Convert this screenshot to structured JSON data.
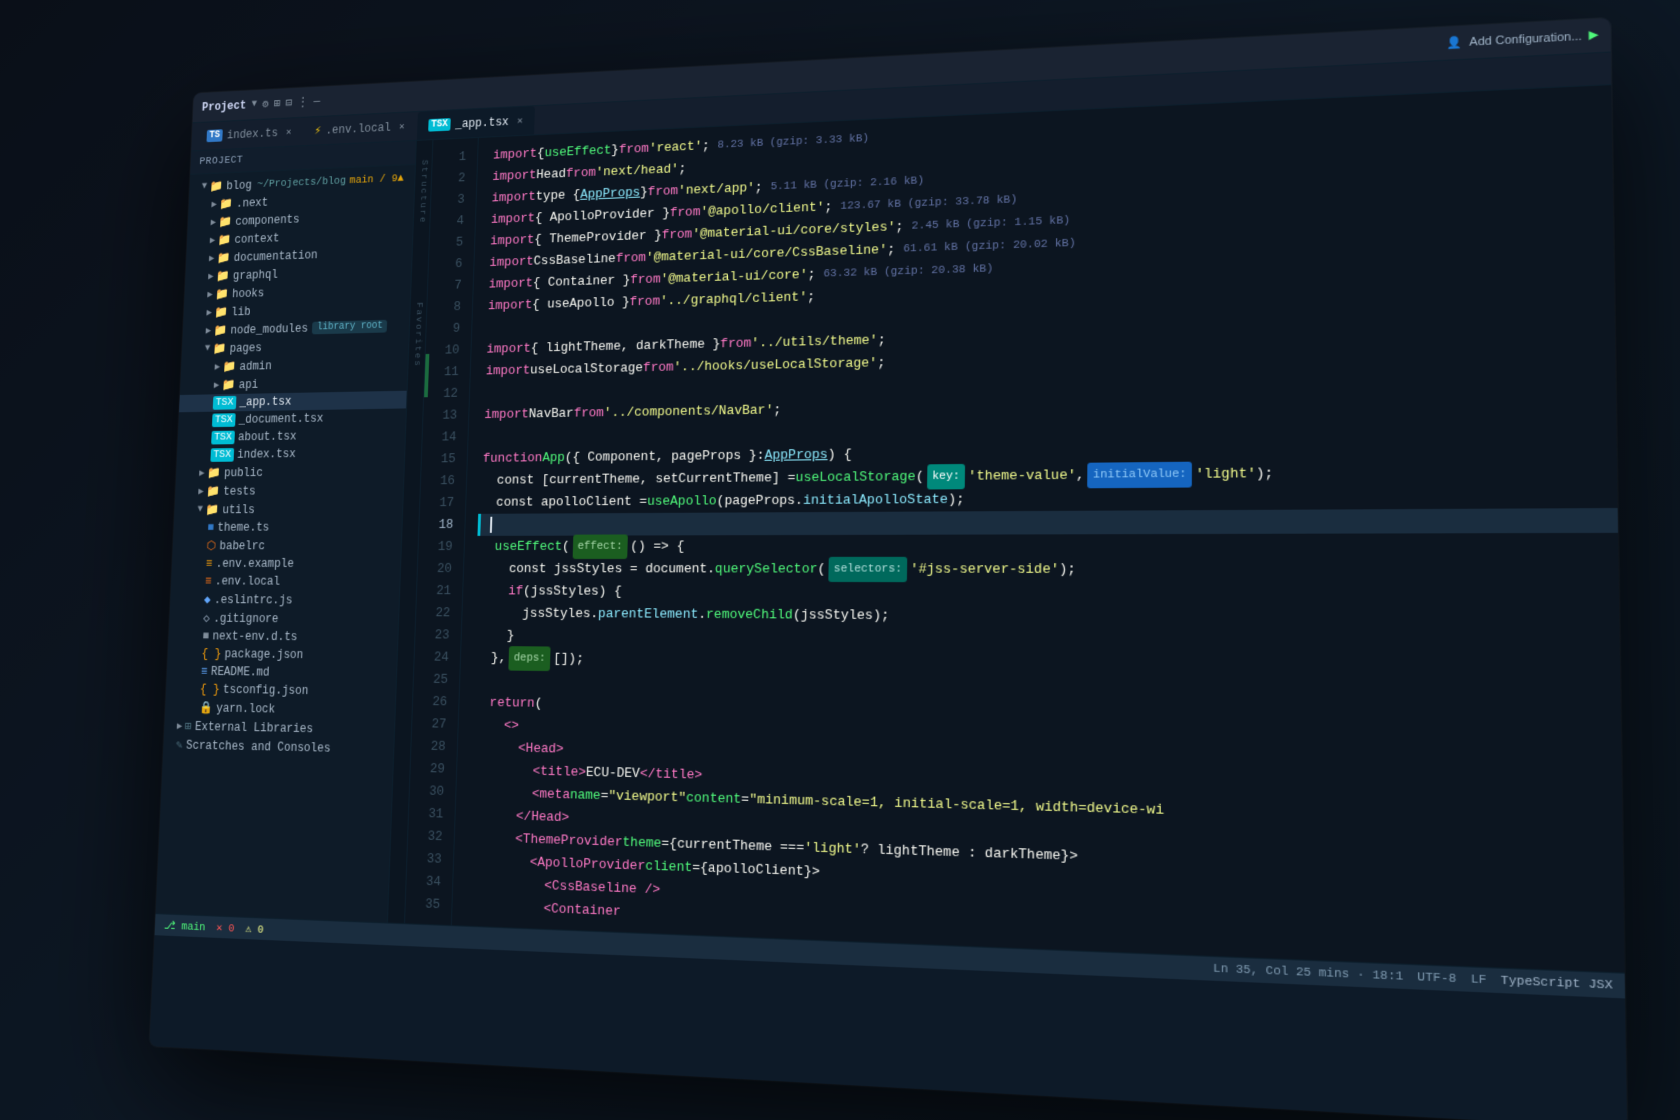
{
  "titlebar": {
    "project": "Project",
    "branch": "main / 9▲",
    "add_config": "Add Configuration...",
    "icons": [
      "⚙",
      "⊞",
      "⊟",
      "⋮",
      "—"
    ]
  },
  "tabs": [
    {
      "id": "index-ts",
      "label": "index.ts",
      "type": "ts",
      "active": false
    },
    {
      "id": "env-local",
      "label": ".env.local",
      "type": "env",
      "active": false
    },
    {
      "id": "app-tsx",
      "label": "_app.tsx",
      "type": "tsx",
      "active": true
    }
  ],
  "sidebar": {
    "title": "Project",
    "items": [
      {
        "indent": 1,
        "type": "folder-open",
        "label": "blog",
        "extra": "~/Projects/blog"
      },
      {
        "indent": 2,
        "type": "folder",
        "label": ".next"
      },
      {
        "indent": 2,
        "type": "folder",
        "label": "components"
      },
      {
        "indent": 2,
        "type": "folder",
        "label": "context"
      },
      {
        "indent": 2,
        "type": "folder",
        "label": "documentation"
      },
      {
        "indent": 2,
        "type": "folder",
        "label": "graphql"
      },
      {
        "indent": 2,
        "type": "folder",
        "label": "hooks"
      },
      {
        "indent": 2,
        "type": "folder",
        "label": "lib"
      },
      {
        "indent": 2,
        "type": "folder-lib",
        "label": "node_modules",
        "badge": "library root"
      },
      {
        "indent": 2,
        "type": "folder-open",
        "label": "pages"
      },
      {
        "indent": 3,
        "type": "folder",
        "label": "admin"
      },
      {
        "indent": 3,
        "type": "folder",
        "label": "api"
      },
      {
        "indent": 3,
        "type": "file-tsx",
        "label": "_app.tsx"
      },
      {
        "indent": 3,
        "type": "file-tsx",
        "label": "_document.tsx"
      },
      {
        "indent": 3,
        "type": "file-tsx",
        "label": "about.tsx"
      },
      {
        "indent": 3,
        "type": "file-tsx",
        "label": "index.tsx"
      },
      {
        "indent": 2,
        "type": "folder",
        "label": "public"
      },
      {
        "indent": 2,
        "type": "folder",
        "label": "tests"
      },
      {
        "indent": 2,
        "type": "folder-open",
        "label": "utils"
      },
      {
        "indent": 3,
        "type": "file-ts",
        "label": "theme.ts"
      },
      {
        "indent": 3,
        "type": "file-yaml",
        "label": "babelrc"
      },
      {
        "indent": 3,
        "type": "file-env",
        "label": ".env.example"
      },
      {
        "indent": 3,
        "type": "file-env2",
        "label": ".env.local"
      },
      {
        "indent": 3,
        "type": "file-lint",
        "label": ".eslintrc.js"
      },
      {
        "indent": 3,
        "type": "file-ignore",
        "label": ".gitignore"
      },
      {
        "indent": 3,
        "type": "file-ts2",
        "label": "next-env.d.ts"
      },
      {
        "indent": 3,
        "type": "file-json",
        "label": "package.json"
      },
      {
        "indent": 3,
        "type": "file-md",
        "label": "README.md"
      },
      {
        "indent": 3,
        "type": "file-json",
        "label": "tsconfig.json"
      },
      {
        "indent": 3,
        "type": "file-lock",
        "label": "yarn.lock"
      },
      {
        "indent": 1,
        "type": "folder",
        "label": "External Libraries"
      },
      {
        "indent": 1,
        "type": "folder",
        "label": "Scratches and Consoles"
      }
    ]
  },
  "editor": {
    "filename": "_app.tsx",
    "lines": [
      {
        "num": 1,
        "code": "import { useEffect } from 'react';",
        "size": "8.23 kB (gzip: 3.33 kB)"
      },
      {
        "num": 2,
        "code": "import Head from 'next/head';"
      },
      {
        "num": 3,
        "code": "import type { AppProps } from 'next/app';",
        "size": "5.11 kB (gzip: 2.16 kB)"
      },
      {
        "num": 4,
        "code": "import { ApolloProvider } from '@apollo/client';",
        "size": "123.67 kB (gzip: 33.78 kB)"
      },
      {
        "num": 5,
        "code": "import { ThemeProvider } from '@material-ui/core/styles';",
        "size": "2.45 kB (gzip: 1.15 kB)"
      },
      {
        "num": 6,
        "code": "import CssBaseline from '@material-ui/core/CssBaseline';",
        "size": "61.61 kB (gzip: 20.02 kB)"
      },
      {
        "num": 7,
        "code": "import { Container } from '@material-ui/core';",
        "size": "63.32 kB (gzip: 20.38 kB)"
      },
      {
        "num": 8,
        "code": "import { useApollo } from '../graphql/client';"
      },
      {
        "num": 9,
        "code": ""
      },
      {
        "num": 10,
        "code": "import { lightTheme, darkTheme } from '../utils/theme';"
      },
      {
        "num": 11,
        "code": "import useLocalStorage from '../hooks/useLocalStorage';"
      },
      {
        "num": 12,
        "code": ""
      },
      {
        "num": 13,
        "code": "import NavBar from '../components/NavBar';"
      },
      {
        "num": 14,
        "code": ""
      },
      {
        "num": 15,
        "code": "function App({ Component, pageProps }: AppProps) {"
      },
      {
        "num": 16,
        "code": "  const [currentTheme, setCurrentTheme] = useLocalStorage( key: 'theme-value',  initialValue: 'light');"
      },
      {
        "num": 17,
        "code": "  const apolloClient = useApollo(pageProps.initialApolloState);"
      },
      {
        "num": 18,
        "code": "",
        "cursor": true
      },
      {
        "num": 19,
        "code": "  useEffect( effect: () => {"
      },
      {
        "num": 20,
        "code": "    const jssStyles = document.querySelector( selectors: '#jss-server-side');"
      },
      {
        "num": 21,
        "code": "    if (jssStyles) {"
      },
      {
        "num": 22,
        "code": "      jssStyles.parentElement.removeChild(jssStyles);"
      },
      {
        "num": 23,
        "code": "    }"
      },
      {
        "num": 24,
        "code": "  },  deps: []);"
      },
      {
        "num": 25,
        "code": ""
      },
      {
        "num": 26,
        "code": "  return ("
      },
      {
        "num": 27,
        "code": "    <>"
      },
      {
        "num": 28,
        "code": "      <Head>"
      },
      {
        "num": 29,
        "code": "        <title>ECU-DEV</title>"
      },
      {
        "num": 30,
        "code": "        <meta name=\"viewport\" content=\"minimum-scale=1, initial-scale=1, width=device-wi"
      },
      {
        "num": 31,
        "code": "      </Head>"
      },
      {
        "num": 32,
        "code": "      <ThemeProvider theme={currentTheme === 'light' ? lightTheme : darkTheme}>"
      },
      {
        "num": 33,
        "code": "        <ApolloProvider client={apolloClient}>"
      },
      {
        "num": 34,
        "code": "          <CssBaseline />"
      },
      {
        "num": 35,
        "code": "          <Container"
      }
    ],
    "cursor_position": "18:1"
  },
  "statusbar": {
    "git": "main",
    "errors": "0",
    "warnings": "0",
    "position": "Ln 35, Col 25 mins · 18:1",
    "encoding": "UTF-8",
    "line_ending": "LF",
    "language": "TypeScript JSX"
  }
}
